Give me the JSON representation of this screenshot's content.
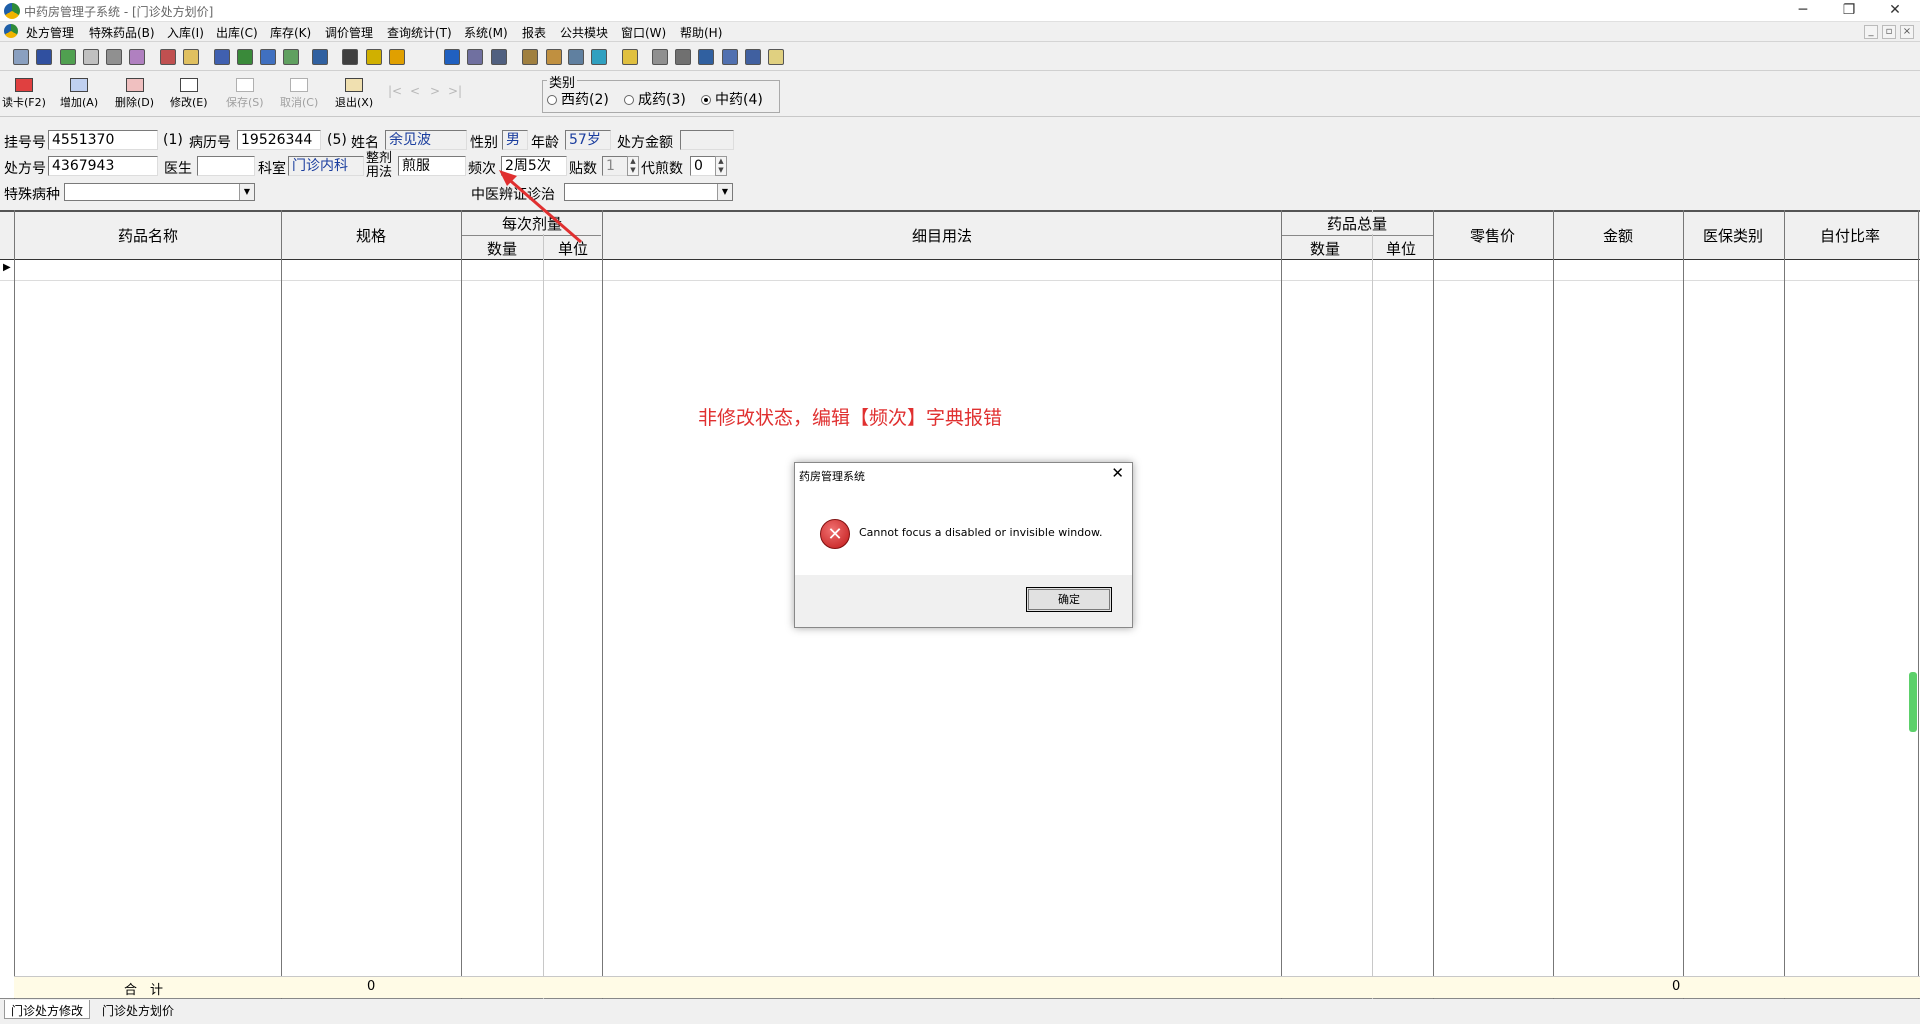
{
  "window": {
    "title": "中药房管理子系统 - [门诊处方划价]",
    "minimize": "─",
    "restore": "❐",
    "close": "✕"
  },
  "menu": [
    "处方管理",
    "特殊药品(B)",
    "入库(I)",
    "出库(C)",
    "库存(K)",
    "调价管理",
    "查询统计(T)",
    "系统(M)",
    "报表",
    "公共模块",
    "窗口(W)",
    "帮助(H)"
  ],
  "commands": {
    "read_card": "读卡(F2)",
    "add": "增加(A)",
    "delete": "删除(D)",
    "modify": "修改(E)",
    "save": "保存(S)",
    "cancel": "取消(C)",
    "exit": "退出(X)"
  },
  "category": {
    "legend": "类别",
    "options": [
      "西药(2)",
      "成药(3)",
      "中药(4)"
    ],
    "selected": "中药(4)"
  },
  "form": {
    "reg_no_label": "挂号号",
    "reg_no": "4551370",
    "hint1": "(1)",
    "record_no_label": "病历号",
    "record_no": "19526344",
    "hint5": "(5)",
    "name_label": "姓名",
    "name": "余见波",
    "sex_label": "性别",
    "sex": "男",
    "age_label": "年龄",
    "age": "57岁",
    "amount_label": "处方金额",
    "amount": "",
    "rx_no_label": "处方号",
    "rx_no": "4367943",
    "doctor_label": "医生",
    "doctor": "",
    "dept_label": "科室",
    "dept": "门诊内科",
    "usage_label_1": "整剂",
    "usage_label_2": "用法",
    "usage": "煎服",
    "freq_label": "频次",
    "freq": "2周5次",
    "doses_label": "贴数",
    "doses": "1",
    "decoct_label": "代煎数",
    "decoct": "0",
    "special_label": "特殊病种",
    "special": "",
    "tcm_label": "中医辨证诊治",
    "tcm": ""
  },
  "grid": {
    "headers": {
      "drug_name": "药品名称",
      "spec": "规格",
      "per_dose": "每次剂量",
      "qty": "数量",
      "unit": "单位",
      "usage_detail": "细目用法",
      "total": "药品总量",
      "retail_price": "零售价",
      "amount": "金额",
      "insurance": "医保类别",
      "self_pay": "自付比率"
    },
    "total_label": "合　计",
    "total_spec": "0",
    "total_amount": "0"
  },
  "tabs": [
    "门诊处方修改",
    "门诊处方划价"
  ],
  "active_tab": "门诊处方修改",
  "annotation": "非修改状态，编辑【频次】字典报错",
  "dialog": {
    "title": "药房管理系统",
    "message": "Cannot focus a disabled or invisible window.",
    "ok": "确定",
    "close": "✕",
    "icon": "error-icon"
  },
  "colors": {
    "annotation": "#e03030",
    "field_text": "#1a3d9e",
    "total_row": "#fffbe6"
  }
}
